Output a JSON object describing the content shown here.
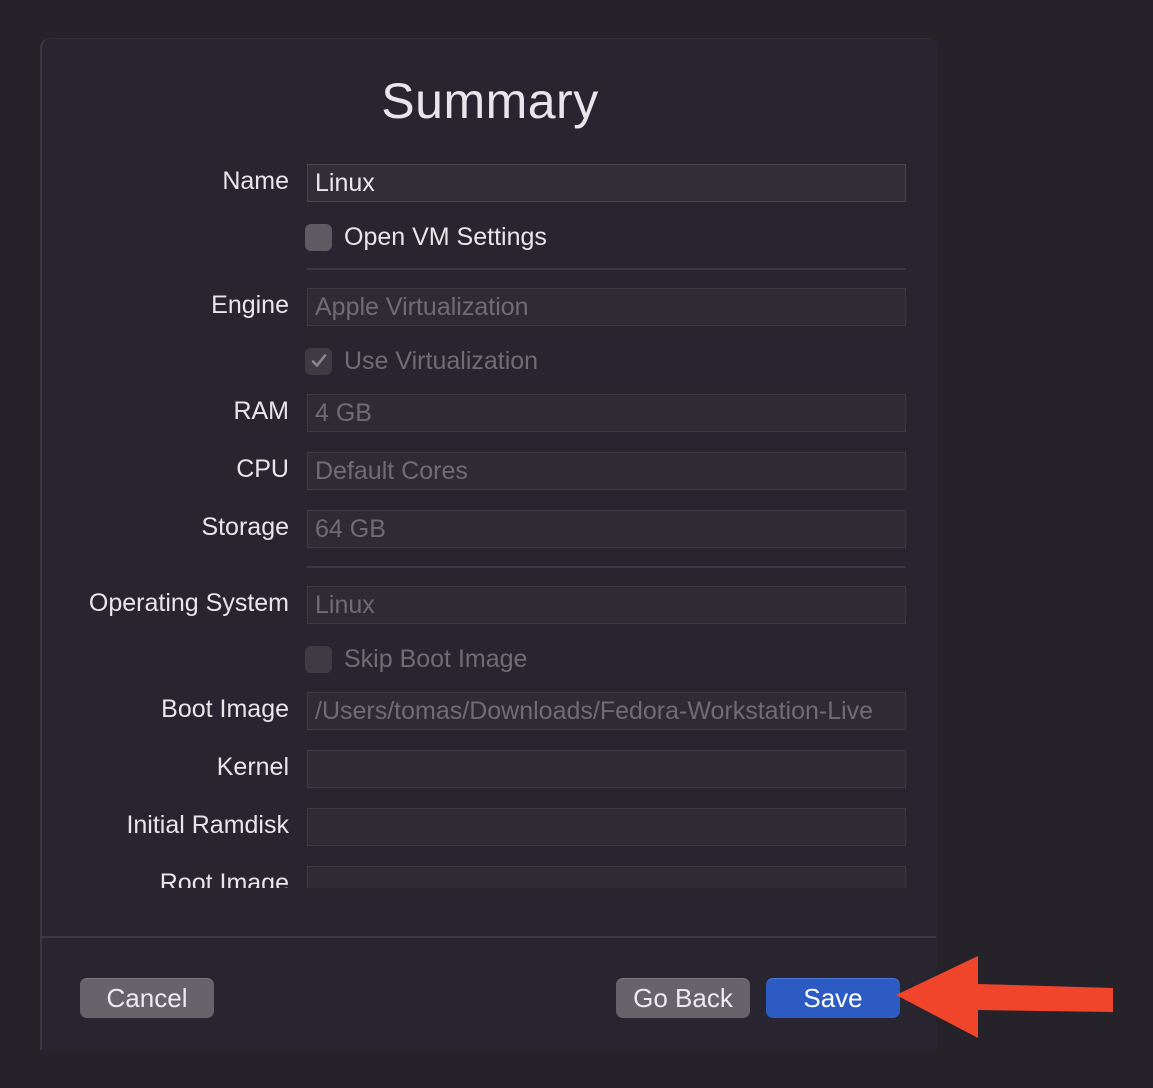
{
  "dialog": {
    "title": "Summary"
  },
  "form": {
    "name_label": "Name",
    "name_value": "Linux",
    "open_vm_settings_label": "Open VM Settings",
    "engine_label": "Engine",
    "engine_value": "Apple Virtualization",
    "use_virtualization_label": "Use Virtualization",
    "ram_label": "RAM",
    "ram_value": "4 GB",
    "cpu_label": "CPU",
    "cpu_value": "Default Cores",
    "storage_label": "Storage",
    "storage_value": "64 GB",
    "os_label": "Operating System",
    "os_value": "Linux",
    "skip_boot_image_label": "Skip Boot Image",
    "boot_image_label": "Boot Image",
    "boot_image_value": "/Users/tomas/Downloads/Fedora-Workstation-Live",
    "kernel_label": "Kernel",
    "kernel_value": "",
    "initial_ramdisk_label": "Initial Ramdisk",
    "initial_ramdisk_value": "",
    "root_image_label": "Root Image",
    "root_image_value": ""
  },
  "footer": {
    "cancel_label": "Cancel",
    "go_back_label": "Go Back",
    "save_label": "Save"
  },
  "colors": {
    "accent": "#2d5bc4",
    "annotation_arrow": "#f0452a"
  },
  "icons": {
    "checkmark": "checkmark-icon",
    "annotation": "arrow-icon"
  }
}
